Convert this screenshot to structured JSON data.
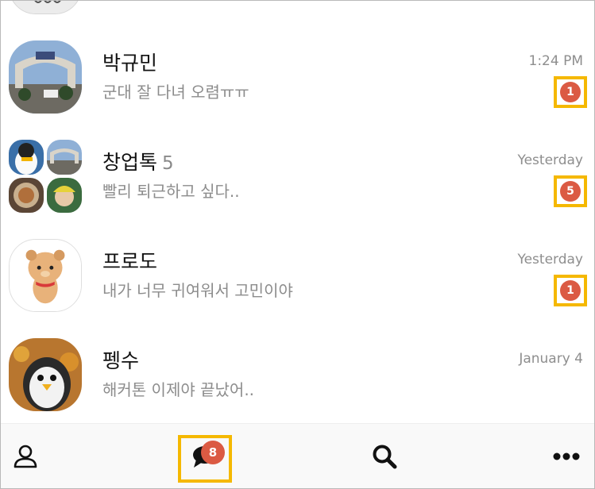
{
  "chat_list": [
    {
      "name": "박규민",
      "member_count": "",
      "preview": "군대 잘 다녀 오렴ㅠㅠ",
      "time": "1:24 PM",
      "unread": "1",
      "avatar_icon": "military-gate-photo-icon"
    },
    {
      "name": "창업톡",
      "member_count": "5",
      "preview": "빨리 퇴근하고 싶다..",
      "time": "Yesterday",
      "unread": "5",
      "avatar_icon": "group-photo-collage-icon"
    },
    {
      "name": "프로도",
      "member_count": "",
      "preview": "내가 너무 귀여워서 고민이야",
      "time": "Yesterday",
      "unread": "1",
      "avatar_icon": "frodo-character-icon"
    },
    {
      "name": "펭수",
      "member_count": "",
      "preview": "해커톤 이제야 끝났어..",
      "time": "January 4",
      "unread": "",
      "avatar_icon": "pengsoo-penguin-icon"
    }
  ],
  "tabbar": {
    "friends_icon": "person-icon",
    "chats_icon": "chat-bubble-icon",
    "chats_badge": "8",
    "search_icon": "search-icon",
    "more_icon": "more-icon"
  },
  "colors": {
    "badge": "#db5a43",
    "highlight": "#f5b800",
    "text_primary": "#111111",
    "text_secondary": "#8c8c8c"
  }
}
